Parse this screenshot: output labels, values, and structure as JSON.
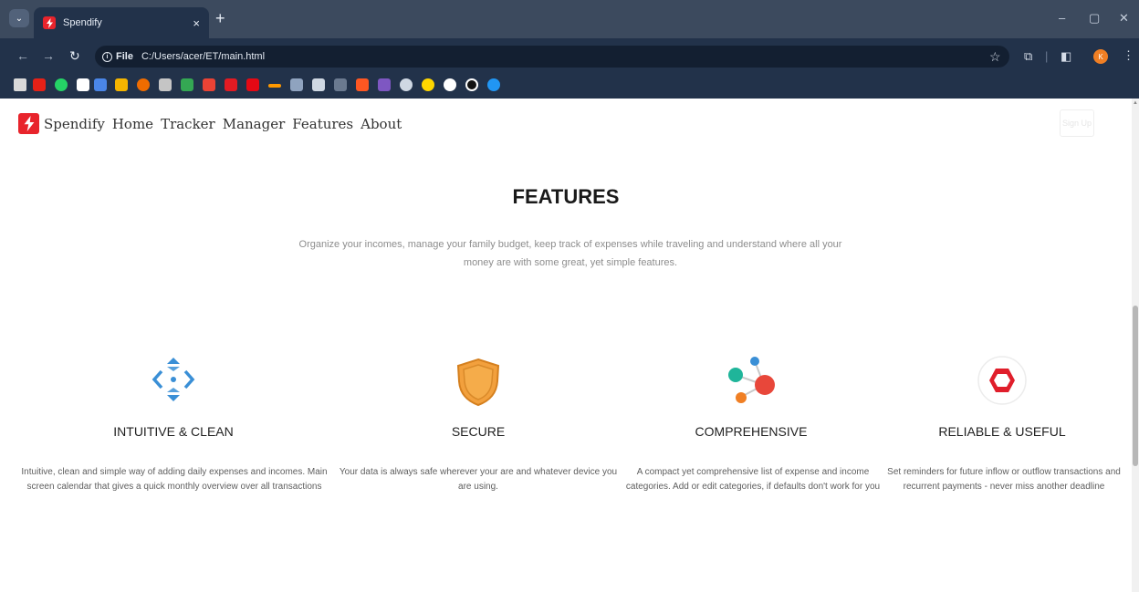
{
  "browser": {
    "tab_title": "Spendify",
    "tab_close": "×",
    "new_tab": "+",
    "info_label": "File",
    "url": "C:/Users/acer/ET/main.html",
    "avatar_initial": "K",
    "window_controls": [
      "–",
      "▢",
      "✕"
    ]
  },
  "nav": {
    "brand": "Spendify",
    "links": [
      "Home",
      "Tracker",
      "Manager",
      "Features",
      "About"
    ],
    "signup": "Sign Up"
  },
  "features": {
    "title": "FEATURES",
    "description": "Organize your incomes, manage your family budget, keep track of expenses while traveling and understand where all your money are with some great, yet simple features.",
    "items": [
      {
        "name": "INTUITIVE & CLEAN",
        "text": "Intuitive, clean and simple way of adding daily expenses and incomes. Main screen calendar that gives a quick monthly overview over all transactions",
        "icon": "move-arrows-icon"
      },
      {
        "name": "SECURE",
        "text": "Your data is always safe wherever your are and whatever device you are using.",
        "icon": "shield-icon"
      },
      {
        "name": "COMPREHENSIVE",
        "text": "A compact yet comprehensive list of expense and income categories. Add or edit categories, if defaults don't work for you",
        "icon": "molecule-icon"
      },
      {
        "name": "RELIABLE & USEFUL",
        "text": "Set reminders for future inflow or outflow transactions and recurrent payments - never miss another deadline",
        "icon": "hexagon-badge-icon"
      }
    ]
  },
  "colors": {
    "brand_red": "#e8242c",
    "icon_blue": "#3a8fd6",
    "icon_orange": "#f2a03d",
    "icon_teal": "#1fb59a",
    "icon_red": "#e8473a",
    "chrome_dark": "#22324a"
  }
}
